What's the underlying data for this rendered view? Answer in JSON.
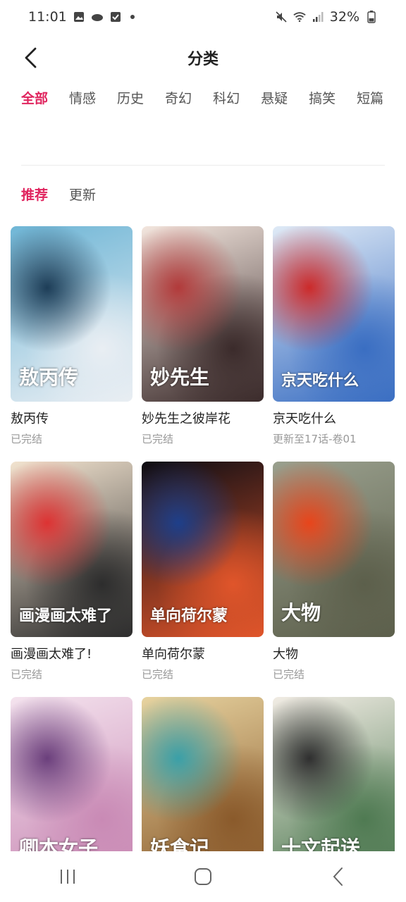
{
  "status": {
    "time": "11:01",
    "battery": "32%"
  },
  "header": {
    "title": "分类"
  },
  "categories": [
    {
      "label": "全部",
      "active": true
    },
    {
      "label": "情感",
      "active": false
    },
    {
      "label": "历史",
      "active": false
    },
    {
      "label": "奇幻",
      "active": false
    },
    {
      "label": "科幻",
      "active": false
    },
    {
      "label": "悬疑",
      "active": false
    },
    {
      "label": "搞笑",
      "active": false
    },
    {
      "label": "短篇",
      "active": false
    }
  ],
  "sort": [
    {
      "label": "推荐",
      "active": true
    },
    {
      "label": "更新",
      "active": false
    }
  ],
  "comics": [
    {
      "title": "敖丙传",
      "status": "已完结",
      "cover_text": "敖丙传",
      "colors": [
        "#6fb6d6",
        "#1d3d57",
        "#e9eef3"
      ]
    },
    {
      "title": "妙先生之彼岸花",
      "status": "已完结",
      "cover_text": "妙先生",
      "colors": [
        "#f3e6de",
        "#b23a3a",
        "#3b2b2b"
      ]
    },
    {
      "title": "京天吃什么",
      "status": "更新至17话-卷01",
      "cover_text": "京天吃什么",
      "colors": [
        "#dfeaf6",
        "#cc2a2a",
        "#3a6ec2"
      ]
    },
    {
      "title": "画漫画太难了!",
      "status": "已完结",
      "cover_text": "画漫画太难了",
      "colors": [
        "#f2e3cf",
        "#d33",
        "#2d2d2d"
      ]
    },
    {
      "title": "单向荷尔蒙",
      "status": "已完结",
      "cover_text": "单向荷尔蒙",
      "colors": [
        "#0d0d14",
        "#1e3f8a",
        "#e0552a"
      ]
    },
    {
      "title": "大物",
      "status": "已完结",
      "cover_text": "大物",
      "colors": [
        "#9aa08e",
        "#e8451b",
        "#5c5f4b"
      ]
    },
    {
      "title": "",
      "status": "",
      "cover_text": "卿本女子",
      "colors": [
        "#f4e3ee",
        "#6b3f7c",
        "#c98ab5"
      ]
    },
    {
      "title": "",
      "status": "",
      "cover_text": "妖食记",
      "colors": [
        "#e7d3a0",
        "#3aa0a8",
        "#8a5a2b"
      ]
    },
    {
      "title": "",
      "status": "",
      "cover_text": "十文起送",
      "colors": [
        "#f1ece4",
        "#2f2f2f",
        "#4f7a52"
      ]
    }
  ]
}
